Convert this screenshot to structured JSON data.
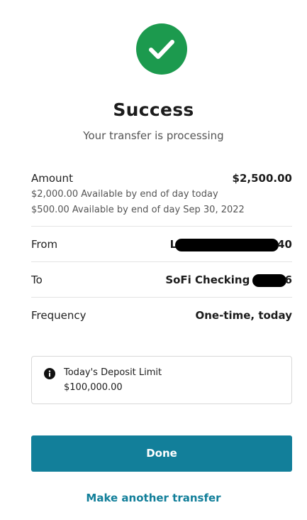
{
  "header": {
    "status_icon": "checkmark-icon",
    "title": "Success",
    "subtitle": "Your transfer is processing"
  },
  "details": {
    "amount": {
      "label": "Amount",
      "value": "$2,500.00",
      "note_1": "$2,000.00 Available by end of day today",
      "note_2": "$500.00 Available by end of day Sep 30, 2022"
    },
    "from": {
      "label": "From",
      "value_prefix": "L",
      "value_suffix": "40"
    },
    "to": {
      "label": "To",
      "value_prefix": "SoFi Checking",
      "value_suffix": "6"
    },
    "frequency": {
      "label": "Frequency",
      "value": "One-time, today"
    }
  },
  "deposit_limit": {
    "icon": "info-icon",
    "label": "Today's Deposit Limit",
    "value": "$100,000.00"
  },
  "actions": {
    "done_label": "Done",
    "another_label": "Make another transfer"
  },
  "colors": {
    "success_green": "#1c9a4e",
    "accent_teal": "#127f9a"
  }
}
